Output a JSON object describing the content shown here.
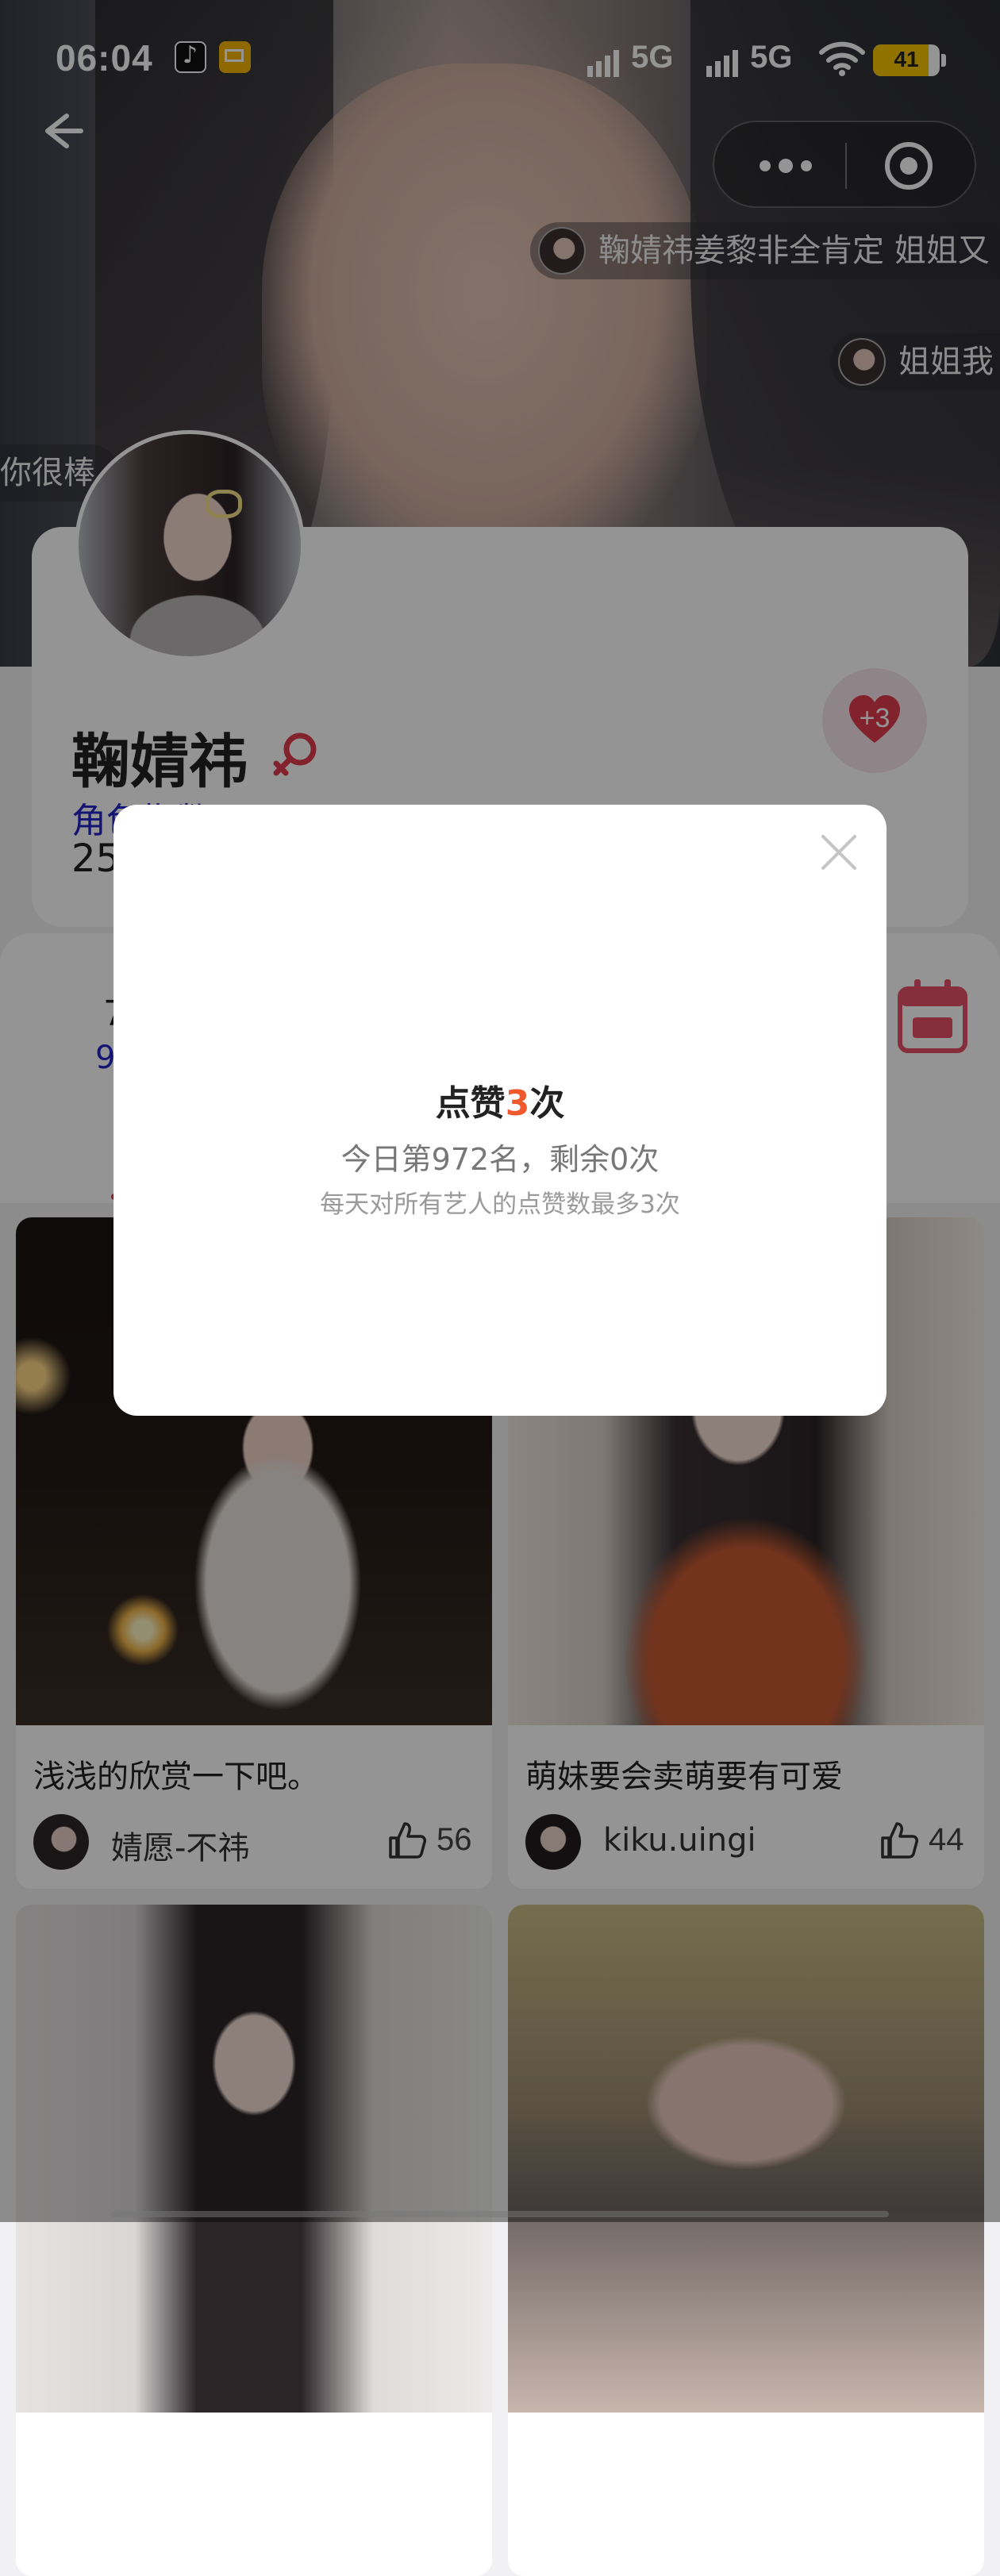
{
  "status_bar": {
    "time": "06:04",
    "network1": "5G",
    "network2": "5G",
    "battery": "41",
    "icons": [
      "tiktok-icon",
      "mail-icon",
      "signal-icon",
      "wifi-icon",
      "battery-icon"
    ]
  },
  "nav": {
    "back_icon": "back-arrow-icon",
    "more_icon": "more-dots-icon",
    "close_icon": "target-circle-icon"
  },
  "danmaku": [
    {
      "text": "鞠婧祎姜黎非全肯定 姐姐又"
    },
    {
      "text": "姐姐我"
    },
    {
      "text": "你很棒"
    }
  ],
  "profile": {
    "name": "鞠婧祎",
    "gender_icon": "female-icon",
    "role_index": "角色指数  9.91",
    "fans": "25",
    "like_button_label": "+3"
  },
  "tabs": {
    "stub_top": "7",
    "stub_bottom": "9"
  },
  "feed": [
    {
      "caption": "浅浅的欣赏一下吧。",
      "user": "婧愿-不祎",
      "likes": "56"
    },
    {
      "caption": "萌妹要会卖萌要有可爱",
      "user": "kiku.uingi",
      "likes": "44"
    }
  ],
  "modal": {
    "title_prefix": "点赞",
    "title_count": "3",
    "title_suffix": "次",
    "rank_text": "今日第972名，剩余0次",
    "limit_text": "每天对所有艺人的点赞数最多3次"
  },
  "colors": {
    "accent_orange": "#f0582e",
    "heart_red": "#e03b4c",
    "link_blue": "#2323c8"
  }
}
